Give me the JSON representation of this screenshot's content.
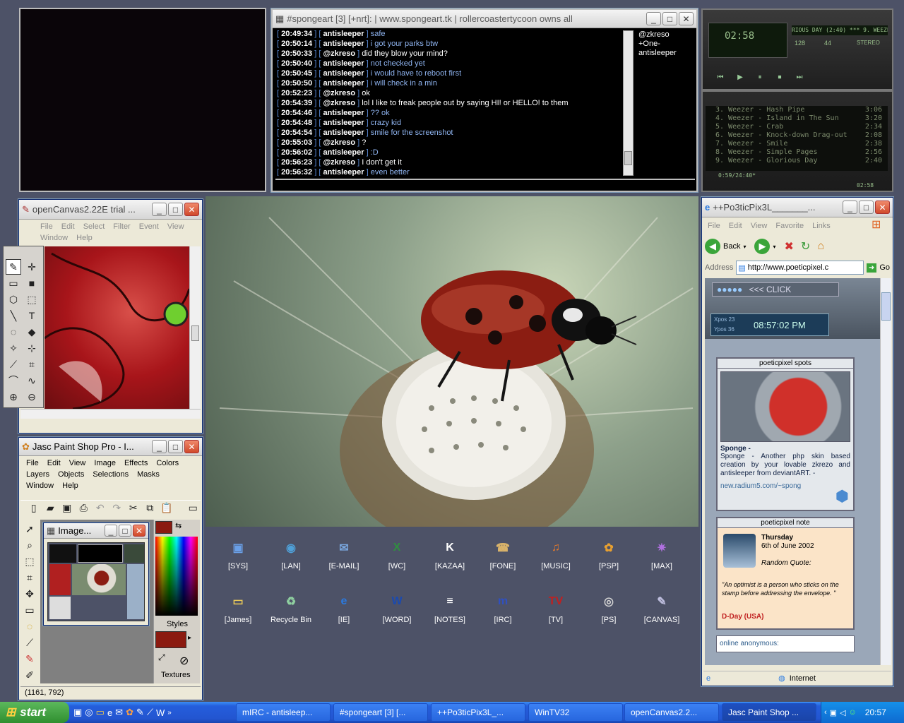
{
  "mirc": {
    "title": "#spongeart [3] [+nrt]:  |  www.spongeart.tk  |  rollercoastertycoon owns all",
    "log": [
      {
        "time": "20:49:34",
        "nick": "antisleeper",
        "msg": "safe",
        "own": false
      },
      {
        "time": "20:50:14",
        "nick": "antisleeper",
        "msg": "i got your parks btw",
        "own": false
      },
      {
        "time": "20:50:33",
        "nick": "@zkreso",
        "msg": "did they blow your mind?",
        "own": true
      },
      {
        "time": "20:50:40",
        "nick": "antisleeper",
        "msg": "not checked yet",
        "own": false
      },
      {
        "time": "20:50:45",
        "nick": "antisleeper",
        "msg": "i would have to reboot first",
        "own": false
      },
      {
        "time": "20:50:50",
        "nick": "antisleeper",
        "msg": "i will check in a min",
        "own": false
      },
      {
        "time": "20:52:23",
        "nick": "@zkreso",
        "msg": "ok",
        "own": true
      },
      {
        "time": "20:54:39",
        "nick": "@zkreso",
        "msg": "lol I like to freak people out by saying HI! or HELLO! to them",
        "own": true
      },
      {
        "time": "20:54:46",
        "nick": "antisleeper",
        "msg": "?? ok",
        "own": false
      },
      {
        "time": "20:54:48",
        "nick": "antisleeper",
        "msg": "crazy kid",
        "own": false
      },
      {
        "time": "20:54:54",
        "nick": "antisleeper",
        "msg": "smile for the screenshot",
        "own": false
      },
      {
        "time": "20:55:03",
        "nick": "@zkreso",
        "msg": "?",
        "own": true
      },
      {
        "time": "20:56:02",
        "nick": "antisleeper",
        "msg": ":D",
        "own": false
      },
      {
        "time": "20:56:23",
        "nick": "@zkreso",
        "msg": "I don't get it",
        "own": true
      },
      {
        "time": "20:56:32",
        "nick": "antisleeper",
        "msg": "even better",
        "own": false
      }
    ],
    "nicklist": [
      "@zkreso",
      "+One-",
      "antisleeper"
    ]
  },
  "winamp": {
    "title_scroll": "RIOUS DAY (2:40)  ***  9. WEEZE",
    "time": "02:58",
    "kbps": "128",
    "khz": "44",
    "stereo": "STEREO",
    "playlist": [
      {
        "title": "3. Weezer - Hash Pipe",
        "len": "3:06"
      },
      {
        "title": "4. Weezer - Island in The Sun",
        "len": "3:20"
      },
      {
        "title": "5. Weezer - Crab",
        "len": "2:34"
      },
      {
        "title": "6. Weezer - Knock-down Drag-out",
        "len": "2:08"
      },
      {
        "title": "7. Weezer - Smile",
        "len": "2:38"
      },
      {
        "title": "8. Weezer - Simple Pages",
        "len": "2:56"
      },
      {
        "title": "9. Weezer - Glorious Day",
        "len": "2:40"
      }
    ],
    "total": "0:59/24:40*",
    "mini_time": "02:58"
  },
  "opencanvas": {
    "title": "openCanvas2.22E trial ...",
    "menu": [
      "File",
      "Edit",
      "Select",
      "Filter",
      "Event",
      "View",
      "Window",
      "Help"
    ]
  },
  "psp": {
    "title": "Jasc Paint Shop Pro - I...",
    "menu": [
      "File",
      "Edit",
      "View",
      "Image",
      "Effects",
      "Colors",
      "Layers",
      "Objects",
      "Selections",
      "Masks",
      "Window",
      "Help"
    ],
    "image_title": "Image...",
    "styles_label": "Styles",
    "textures_label": "Textures",
    "status": "(1161, 792)"
  },
  "ie": {
    "title": "++Po3ticPix3L_______...",
    "menu": [
      "File",
      "Edit",
      "View",
      "Favorite",
      "Links"
    ],
    "back_label": "Back",
    "address_label": "Address",
    "address": "http://www.poeticpixel.c",
    "go_label": "Go",
    "status": "Internet",
    "click_label": "<<< CLICK",
    "xpos": "Xpos  23",
    "ypos": "Ypos  36",
    "clock": "08:57:02 PM",
    "spots_title": "poeticpixel spots",
    "spots_heading": "Sponge -",
    "spots_text": "Sponge - Another php skin based creation by your lovable zkrezo and antisleeper from deviantART. -",
    "spots_link": "new.radium5.com/~spong",
    "note_title": "poeticpixel note",
    "note_day": "Thursday",
    "note_date": "6th of June 2002",
    "note_quote_label": "Random Quote:",
    "note_quote": "\"An optimist is a person who sticks on the stamp before addressing the envelope. \"",
    "note_event": "D-Day (USA)",
    "online": "online anonymous:"
  },
  "desktop_icons": [
    {
      "label": "[SYS]",
      "glyph": "▣",
      "color": "#6aa0e8"
    },
    {
      "label": "[LAN]",
      "glyph": "◉",
      "color": "#4fa0d8"
    },
    {
      "label": "[E-MAIL]",
      "glyph": "✉",
      "color": "#7aa8e0"
    },
    {
      "label": "[WC]",
      "glyph": "X",
      "color": "#2f8f3f"
    },
    {
      "label": "[KAZAA]",
      "glyph": "K",
      "color": "#ffffff"
    },
    {
      "label": "[FONE]",
      "glyph": "☎",
      "color": "#d9b36a"
    },
    {
      "label": "[MUSIC]",
      "glyph": "♫",
      "color": "#e87a2a"
    },
    {
      "label": "[PSP]",
      "glyph": "✿",
      "color": "#e8a030"
    },
    {
      "label": "[MAX]",
      "glyph": "✷",
      "color": "#b070e0"
    },
    {
      "label": "[James]",
      "glyph": "▭",
      "color": "#e8c858"
    },
    {
      "label": "Recycle Bin",
      "glyph": "♻",
      "color": "#8fd0a0"
    },
    {
      "label": "[IE]",
      "glyph": "e",
      "color": "#2a7ae0"
    },
    {
      "label": "[WORD]",
      "glyph": "W",
      "color": "#1a4ab0"
    },
    {
      "label": "[NOTES]",
      "glyph": "≡",
      "color": "#ffffff"
    },
    {
      "label": "[IRC]",
      "glyph": "m",
      "color": "#3050c0"
    },
    {
      "label": "[TV]",
      "glyph": "TV",
      "color": "#c02020"
    },
    {
      "label": "[PS]",
      "glyph": "◎",
      "color": "#d0d0d0"
    },
    {
      "label": "[CANVAS]",
      "glyph": "✎",
      "color": "#c0c0e0"
    }
  ],
  "taskbar": {
    "start_label": "start",
    "tasks": [
      {
        "label": "mIRC - antisleep...",
        "active": false
      },
      {
        "label": "#spongeart [3] [...",
        "active": false
      },
      {
        "label": "++Po3ticPix3L_...",
        "active": false
      },
      {
        "label": "WinTV32",
        "active": false
      },
      {
        "label": "openCanvas2.2...",
        "active": false
      },
      {
        "label": "Jasc Paint Shop ...",
        "active": true
      }
    ],
    "clock": "20:57"
  },
  "colors": {
    "desktop": "#4d5267",
    "xp_blue": "#2766de",
    "start_green": "#3a9a3a",
    "irc_bg": "#000000",
    "accent_red": "#8b1a10"
  }
}
